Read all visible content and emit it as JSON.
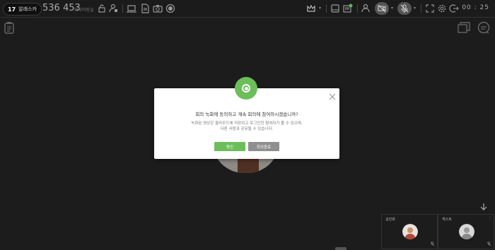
{
  "header": {
    "room_number": "17",
    "room_name": "알래스카",
    "meeting_id": "536 453",
    "meeting_label": "외부미팅실",
    "timer": "00 : 25"
  },
  "icons": {
    "toolbar": [
      "lock-icon",
      "user-lock-icon",
      "laptop-icon",
      "document-icon",
      "camera-icon",
      "record-icon",
      "crown-icon",
      "hard-drive-icon",
      "chat-icon",
      "participants-icon",
      "camera-off-icon",
      "mic-off-icon",
      "fullscreen-icon",
      "gear-icon",
      "exit-icon"
    ],
    "side": [
      "notes-icon",
      "layout-icon",
      "chat-bubble-icon"
    ]
  },
  "dialog": {
    "title": "회의 녹화에 동의하고 계속 회의에 참여하시겠습니까?",
    "message_line1": "녹화된 영상은 클라우드에 저장되고 로그인한 참여자가 볼 수 있으며,",
    "message_line2": "다른 사람과 공유될 수 있습니다.",
    "confirm_label": "확인",
    "end_label": "회의종료",
    "accent_color": "#6cbe5a"
  },
  "participants": [
    {
      "name": "김민희",
      "corner": ""
    },
    {
      "name": "게스트",
      "corner": "⋮"
    }
  ],
  "chat_badge_color": "#5cb85c"
}
